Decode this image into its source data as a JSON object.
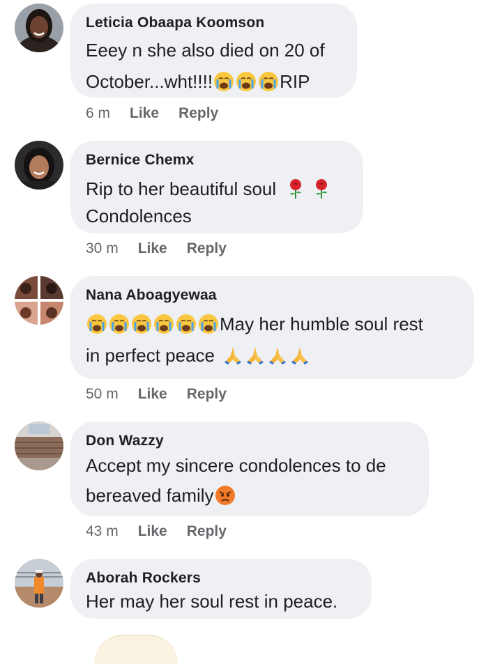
{
  "comments": [
    {
      "author": "Leticia Obaapa Koomson",
      "line1": "Eeey n she also died on 20 of",
      "line2": "October...wht!!!!",
      "line2_tail": "RIP",
      "time": "6 m",
      "like": "Like",
      "reply": "Reply",
      "emojis": [
        "crying-face",
        "crying-face",
        "crying-face"
      ]
    },
    {
      "author": "Bernice Chemx",
      "line1": "Rip to her beautiful soul",
      "line2": "Condolences",
      "time": "30 m",
      "like": "Like",
      "reply": "Reply",
      "emojis": [
        "rose",
        "rose"
      ]
    },
    {
      "author": "Nana Aboagyewaa",
      "line1": "May her humble soul rest",
      "line2": "in perfect peace",
      "time": "50 m",
      "like": "Like",
      "reply": "Reply",
      "emojis": [
        "crying-face",
        "crying-face",
        "crying-face",
        "crying-face",
        "crying-face",
        "crying-face",
        "praying-hands",
        "praying-hands",
        "praying-hands",
        "praying-hands"
      ]
    },
    {
      "author": "Don Wazzy",
      "line1": "Accept my sincere condolences to de",
      "line2": "bereaved family",
      "time": "43 m",
      "like": "Like",
      "reply": "Reply",
      "emojis": [
        "angry-face"
      ]
    },
    {
      "author": "Aborah Rockers",
      "line1": "Her may her soul rest in peace.",
      "emojis": []
    }
  ],
  "colors": {
    "bubble": "#eff0f3",
    "text": "#1c1e21",
    "meta": "#65676b"
  }
}
